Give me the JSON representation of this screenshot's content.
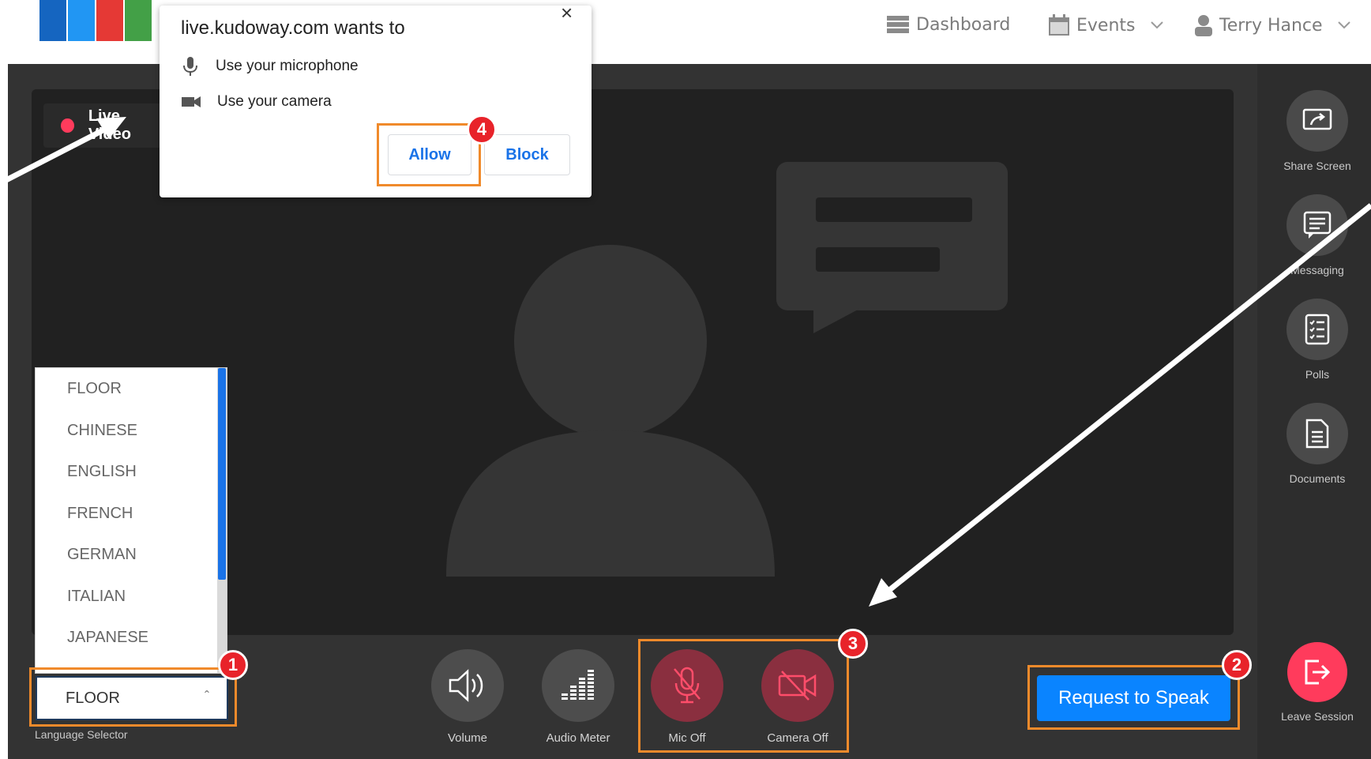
{
  "header": {
    "nav": [
      {
        "label": "Dashboard",
        "icon": "dashboard-icon"
      },
      {
        "label": "Events",
        "icon": "calendar-icon"
      },
      {
        "label": "Terry Hance",
        "icon": "user-icon"
      }
    ]
  },
  "video": {
    "live_label": "Live Video"
  },
  "permission_popup": {
    "title": "live.kudoway.com wants to",
    "items": [
      {
        "label": "Use your microphone",
        "icon": "microphone-icon"
      },
      {
        "label": "Use your camera",
        "icon": "camera-icon"
      }
    ],
    "allow_label": "Allow",
    "block_label": "Block"
  },
  "sidebar": {
    "tools": [
      {
        "label": "Share Screen",
        "icon": "share-screen-icon"
      },
      {
        "label": "Messaging",
        "icon": "messaging-icon"
      },
      {
        "label": "Polls",
        "icon": "polls-icon"
      },
      {
        "label": "Documents",
        "icon": "documents-icon"
      }
    ],
    "leave_label": "Leave Session"
  },
  "controls": {
    "volume_label": "Volume",
    "audio_meter_label": "Audio Meter",
    "mic_label": "Mic Off",
    "camera_label": "Camera Off",
    "request_label": "Request to Speak"
  },
  "language": {
    "selected": "FLOOR",
    "label": "Language Selector",
    "options": [
      "FLOOR",
      "CHINESE",
      "ENGLISH",
      "FRENCH",
      "GERMAN",
      "ITALIAN",
      "JAPANESE"
    ]
  },
  "annotations": {
    "badges": [
      "1",
      "2",
      "3",
      "4"
    ]
  },
  "colors": {
    "accent": "#0a84ff",
    "highlight": "#f08a2b",
    "badge": "#e8232a",
    "danger": "#ff3b5c"
  }
}
